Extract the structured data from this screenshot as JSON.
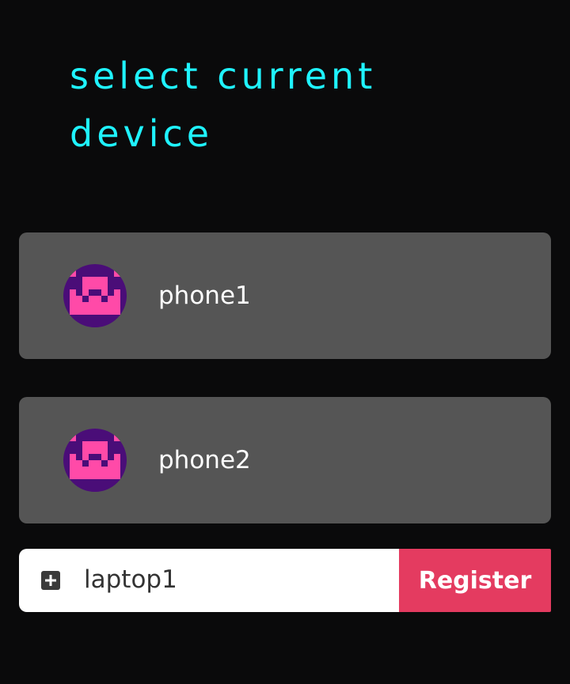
{
  "page": {
    "title": "select current device"
  },
  "devices": [
    {
      "name": "phone1",
      "avatar_icon": "pixel-robot-avatar-icon"
    },
    {
      "name": "phone2",
      "avatar_icon": "pixel-robot-avatar-icon"
    }
  ],
  "register": {
    "icon": "plus-square-icon",
    "input_value": "laptop1",
    "button_label": "Register"
  },
  "colors": {
    "background": "#0a0a0b",
    "title": "#1ff3ff",
    "card": "#555555",
    "avatar_bg": "#4a0d78",
    "avatar_fg": "#ff4aa8",
    "register_button": "#e43b60"
  }
}
